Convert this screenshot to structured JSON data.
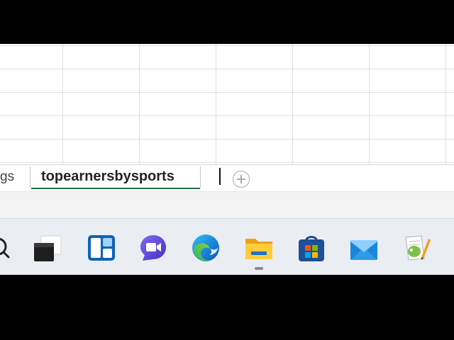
{
  "sheet_tabs": {
    "previous_tab_label": "gs",
    "active_tab_label": "topearnersbysports",
    "add_sheet_icon": "plus-circle-icon"
  },
  "taskbar": {
    "icons": [
      {
        "name": "search-icon"
      },
      {
        "name": "task-view-icon"
      },
      {
        "name": "widgets-icon"
      },
      {
        "name": "chat-icon"
      },
      {
        "name": "edge-icon"
      },
      {
        "name": "file-explorer-icon"
      },
      {
        "name": "microsoft-store-icon"
      },
      {
        "name": "mail-icon"
      },
      {
        "name": "notepad-plus-icon"
      }
    ]
  },
  "colors": {
    "active_tab_underline": "#1e7145",
    "taskbar_background": "#eaeef3",
    "grid_line": "#e1e1e1"
  }
}
